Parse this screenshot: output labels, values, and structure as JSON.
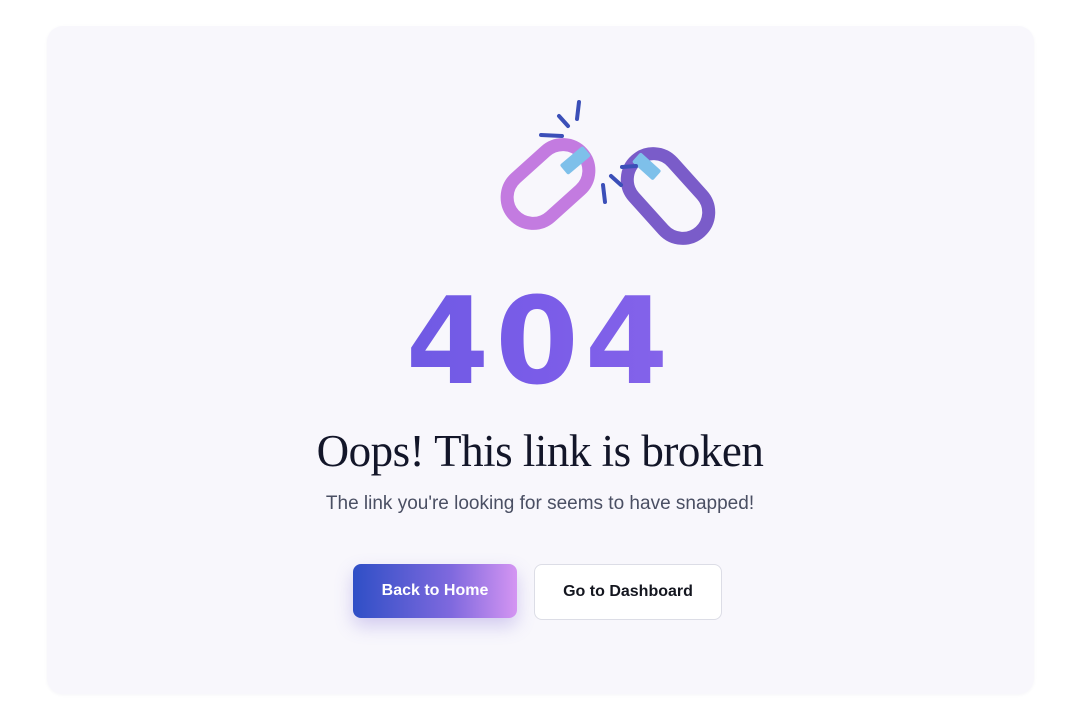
{
  "error": {
    "code": "404",
    "title": "Oops! This link is broken",
    "message": "The link you're looking for seems to have snapped!"
  },
  "illustration": {
    "icon": "broken-chain-icon",
    "colors": {
      "left_link": "#c37be0",
      "right_link": "#7a5cc9",
      "tape": "#7ec0ea",
      "sparks": "#3b4fb8"
    }
  },
  "actions": {
    "primary_label": "Back to Home",
    "secondary_label": "Go to Dashboard"
  },
  "colors": {
    "accent_start": "#2f4fc6",
    "accent_end": "#d495f2",
    "card_background": "#f8f7fc",
    "text_dark": "#131629"
  }
}
